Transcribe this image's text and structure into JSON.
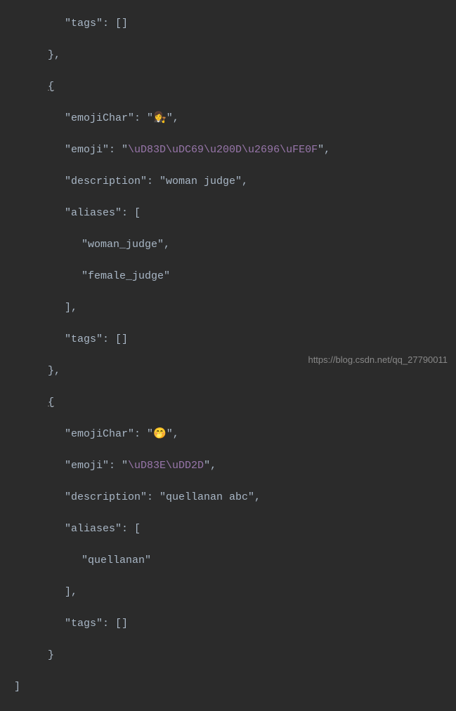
{
  "code": {
    "line1_key": "\"tags\"",
    "line1_val": ": []",
    "line2": "},",
    "line3": "{",
    "line4_key": "\"emojiChar\"",
    "line4_sep": ": \"",
    "line4_emoji": "👩‍⚖️",
    "line4_end": "\",",
    "line5_key": "\"emoji\"",
    "line5_sep": ": \"",
    "line5_escape": "\\uD83D\\uDC69\\u200D\\u2696\\uFE0F",
    "line5_end": "\",",
    "line6_key": "\"description\"",
    "line6_val": ": \"woman judge\",",
    "line7_key": "\"aliases\"",
    "line7_val": ": [",
    "line8": "\"woman_judge\",",
    "line9": "\"female_judge\"",
    "line10": "],",
    "line11_key": "\"tags\"",
    "line11_val": ": []",
    "line12": "},",
    "line13": "{",
    "line14_key": "\"emojiChar\"",
    "line14_sep": ": \"",
    "line14_emoji": "🤭",
    "line14_end": "\",",
    "line15_key": "\"emoji\"",
    "line15_sep": ": \"",
    "line15_escape": "\\uD83E\\uDD2D",
    "line15_end": "\",",
    "line16_key": "\"description\"",
    "line16_val": ": \"quellanan abc\",",
    "line17_key": "\"aliases\"",
    "line17_val": ": [",
    "line18": "\"quellanan\"",
    "line19": "],",
    "line20_key": "\"tags\"",
    "line20_val": ": []",
    "line21": "}",
    "line22": "]"
  },
  "watermark": "https://blog.csdn.net/qq_27790011"
}
